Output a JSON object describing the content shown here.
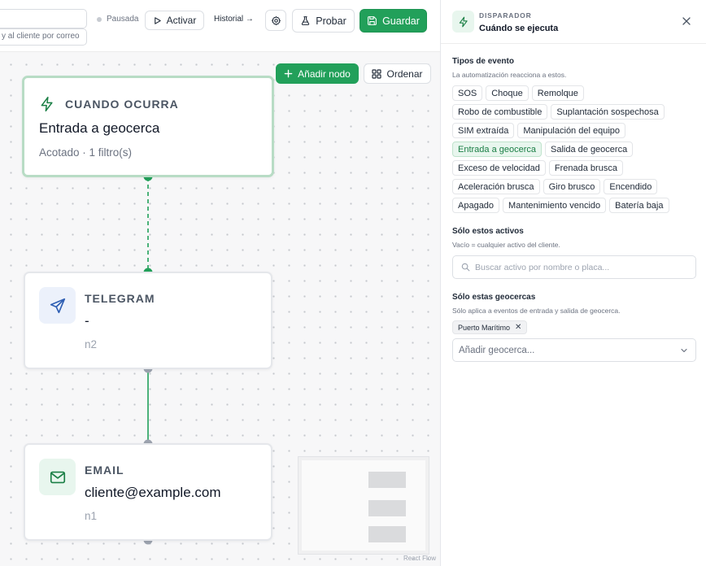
{
  "topbar": {
    "description_value": "y al cliente por correo",
    "status_label": "Pausada",
    "activate_label": "Activar",
    "history_label": "Historial →",
    "test_label": "Probar",
    "save_label": "Guardar"
  },
  "canvas": {
    "add_node_label": "Añadir nodo",
    "order_label": "Ordenar",
    "attribution": "React Flow"
  },
  "nodes": {
    "trigger": {
      "kicker": "CUANDO OCURRA",
      "title": "Entrada a geocerca",
      "subtitle": "Acotado · 1 filtro(s)"
    },
    "telegram": {
      "kicker": "TELEGRAM",
      "title": "-",
      "id": "n2"
    },
    "email": {
      "kicker": "EMAIL",
      "title": "cliente@example.com",
      "id": "n1"
    }
  },
  "panel": {
    "kicker": "DISPARADOR",
    "title": "Cuándo se ejecuta",
    "event_types": {
      "title": "Tipos de evento",
      "hint": "La automatización reacciona a estos.",
      "rows": [
        [
          "SOS",
          "Choque",
          "Remolque"
        ],
        [
          "Robo de combustible",
          "Suplantación sospechosa"
        ],
        [
          "SIM extraída",
          "Manipulación del equipo"
        ],
        [
          "Entrada a geocerca",
          "Salida de geocerca"
        ],
        [
          "Exceso de velocidad",
          "Frenada brusca"
        ],
        [
          "Aceleración brusca",
          "Giro brusco",
          "Encendido"
        ],
        [
          "Apagado",
          "Mantenimiento vencido",
          "Batería baja"
        ]
      ],
      "selected": "Entrada a geocerca"
    },
    "assets": {
      "title": "Sólo estos activos",
      "hint": "Vacío = cualquier activo del cliente.",
      "search_placeholder": "Buscar activo por nombre o placa..."
    },
    "geofences": {
      "title": "Sólo estas geocercas",
      "hint": "Sólo aplica a eventos de entrada y salida de geocerca.",
      "tags": [
        "Puerto Marítimo"
      ],
      "add_placeholder": "Añadir geocerca..."
    }
  },
  "colors": {
    "accent": "#22a05a",
    "accent_soft": "#e8f6ee",
    "telegram_icon": "#2f5fb3",
    "edge_dot": "#22a05a",
    "edge_dot_inactive": "#9ca3af"
  },
  "icons": {
    "trigger": "lightning-icon",
    "telegram": "send-icon",
    "email": "mail-icon",
    "gear": "gear-icon",
    "test": "flask-icon",
    "save": "floppy-icon",
    "order": "grid-icon",
    "search": "search-icon",
    "close": "close-icon",
    "chevron": "chevron-down-icon"
  }
}
